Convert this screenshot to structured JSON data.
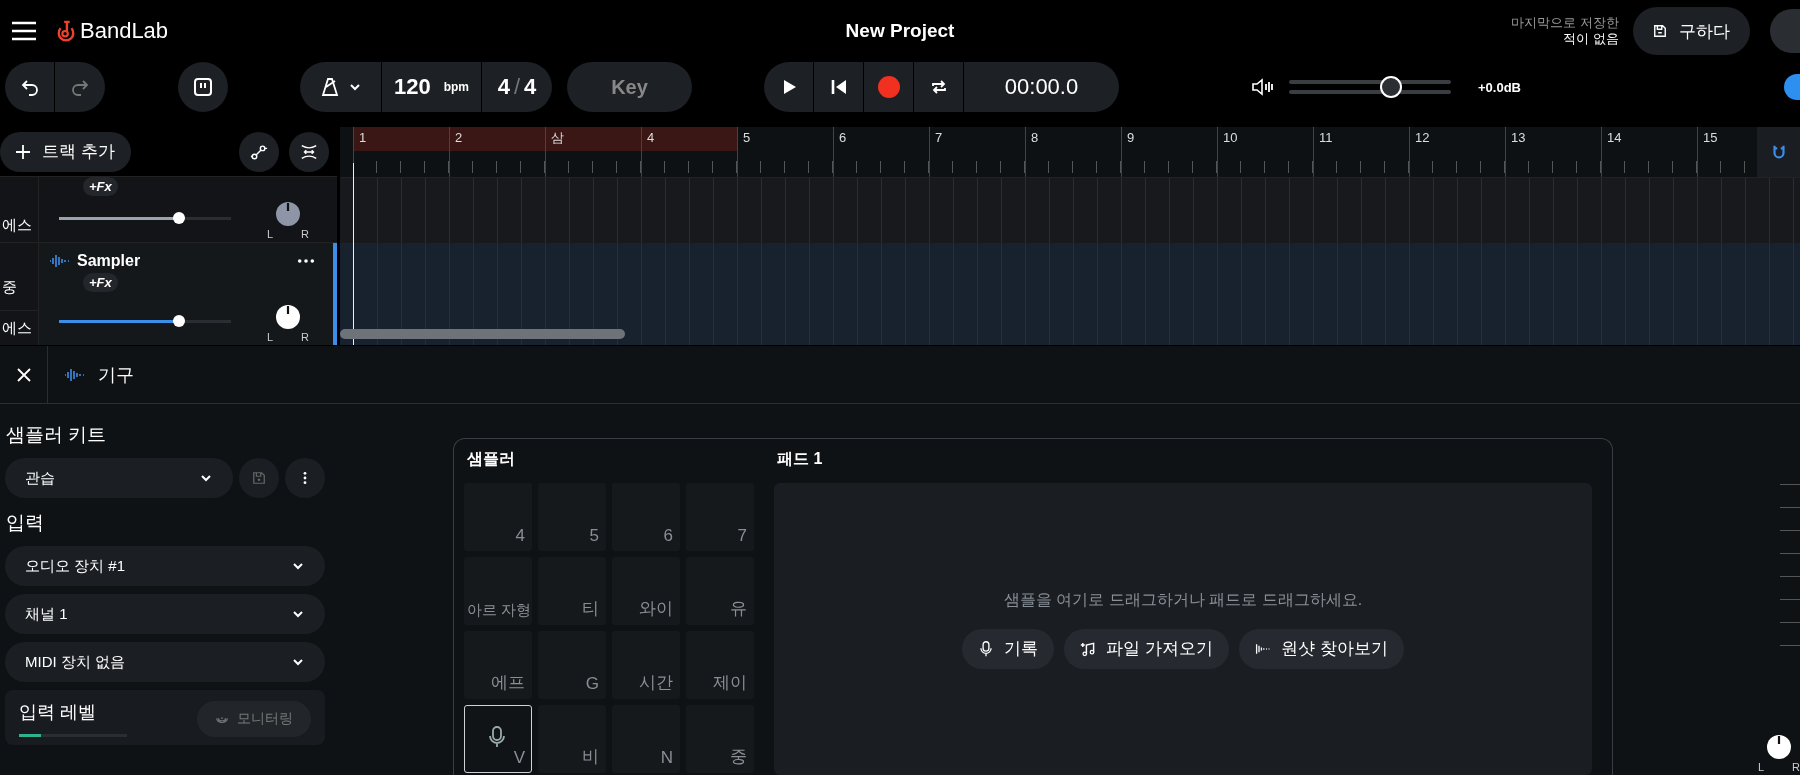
{
  "header": {
    "logo": "BandLab",
    "project_title": "New Project",
    "save_status": [
      "마지막으로 저장한",
      "적이 없음"
    ],
    "save_button": "구하다"
  },
  "toolbar": {
    "redo_disabled": true,
    "tempo": "120",
    "tempo_unit": "bpm",
    "time_signature": {
      "beats": "4",
      "separator": "/",
      "unit": "4"
    },
    "key": {
      "label": "Key",
      "disabled": true
    },
    "record_armed": true,
    "time": "00:00.0",
    "volume": {
      "level": 0.63,
      "reading": "+0.0dB"
    }
  },
  "tracks_panel": {
    "add_track": "트랙 추가"
  },
  "ruler": {
    "bars": [
      {
        "label": "1",
        "looped": true
      },
      {
        "label": "2",
        "looped": true
      },
      {
        "label": "삼",
        "looped": true
      },
      {
        "label": "4",
        "looped": true
      },
      {
        "label": "5",
        "looped": false
      },
      {
        "label": "6",
        "looped": false
      },
      {
        "label": "7",
        "looped": false
      },
      {
        "label": "8",
        "looped": false
      },
      {
        "label": "9",
        "looped": false
      },
      {
        "label": "10",
        "looped": false
      },
      {
        "label": "11",
        "looped": false
      },
      {
        "label": "12",
        "looped": false
      },
      {
        "label": "13",
        "looped": false
      },
      {
        "label": "14",
        "looped": false
      },
      {
        "label": "15",
        "looped": false
      }
    ],
    "snap_on": true
  },
  "tracks": [
    {
      "selected": false,
      "fx": "+Fx",
      "buttons": [
        "에스"
      ],
      "level": 0.7,
      "pan": {
        "left": "L",
        "right": "R"
      }
    },
    {
      "selected": true,
      "name": "Sampler",
      "fx": "+Fx",
      "buttons": [
        "중",
        "에스"
      ],
      "level": 0.7,
      "pan": {
        "left": "L",
        "right": "R"
      }
    }
  ],
  "bottom_panel": {
    "tab": "기구",
    "kit": {
      "label": "샘플러 키트",
      "preset": "관습"
    },
    "input": {
      "label": "입력",
      "selects": [
        "오디오 장치 #1",
        "채널 1",
        "MIDI 장치 없음"
      ],
      "level_label": "입력 레벨",
      "level": 0.2,
      "monitor": {
        "label": "모니터링",
        "disabled": true
      }
    },
    "sampler": {
      "title": "샘플러",
      "pads": [
        {
          "label": "4",
          "selected": false
        },
        {
          "label": "5",
          "selected": false
        },
        {
          "label": "6",
          "selected": false
        },
        {
          "label": "7",
          "selected": false
        },
        {
          "label": "아르 자형",
          "selected": false
        },
        {
          "label": "티",
          "selected": false
        },
        {
          "label": "와이",
          "selected": false
        },
        {
          "label": "유",
          "selected": false
        },
        {
          "label": "에프",
          "selected": false
        },
        {
          "label": "G",
          "selected": false
        },
        {
          "label": "시간",
          "selected": false
        },
        {
          "label": "제이",
          "selected": false
        },
        {
          "label": "V",
          "selected": true
        },
        {
          "label": "비",
          "selected": false
        },
        {
          "label": "N",
          "selected": false
        },
        {
          "label": "중",
          "selected": false
        }
      ],
      "pad_title": "패드 1",
      "hint": "샘플을 여기로 드래그하거나 패드로 드래그하세요.",
      "actions": [
        {
          "kind": "record",
          "label": "기록"
        },
        {
          "kind": "import",
          "label": "파일 가져오기"
        },
        {
          "kind": "browse",
          "label": "원샷 찾아보기"
        }
      ]
    },
    "output_pan": {
      "left": "L",
      "right": "R"
    }
  }
}
